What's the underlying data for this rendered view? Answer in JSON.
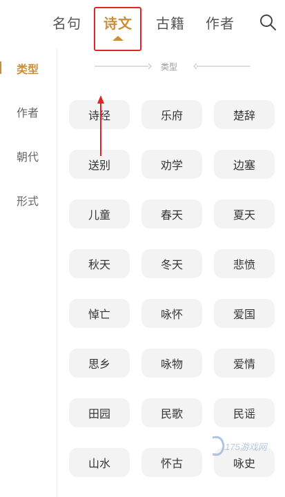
{
  "tabs": [
    {
      "label": "名句",
      "active": false
    },
    {
      "label": "诗文",
      "active": true
    },
    {
      "label": "古籍",
      "active": false
    },
    {
      "label": "作者",
      "active": false
    }
  ],
  "search_icon": "search-icon",
  "accent_color": "#c98d3c",
  "sidebar": {
    "items": [
      {
        "label": "类型",
        "active": true
      },
      {
        "label": "作者",
        "active": false
      },
      {
        "label": "朝代",
        "active": false
      },
      {
        "label": "形式",
        "active": false
      }
    ]
  },
  "section": {
    "title": "类型"
  },
  "categories": [
    "诗经",
    "乐府",
    "楚辞",
    "送别",
    "劝学",
    "边塞",
    "儿童",
    "春天",
    "夏天",
    "秋天",
    "冬天",
    "悲愤",
    "悼亡",
    "咏怀",
    "爱国",
    "思乡",
    "咏物",
    "爱情",
    "田园",
    "民歌",
    "民谣",
    "山水",
    "怀古",
    "咏史"
  ],
  "annotation": {
    "highlight_color": "#e02424",
    "target": "诗文"
  },
  "watermark": {
    "text": "175游戏网"
  }
}
